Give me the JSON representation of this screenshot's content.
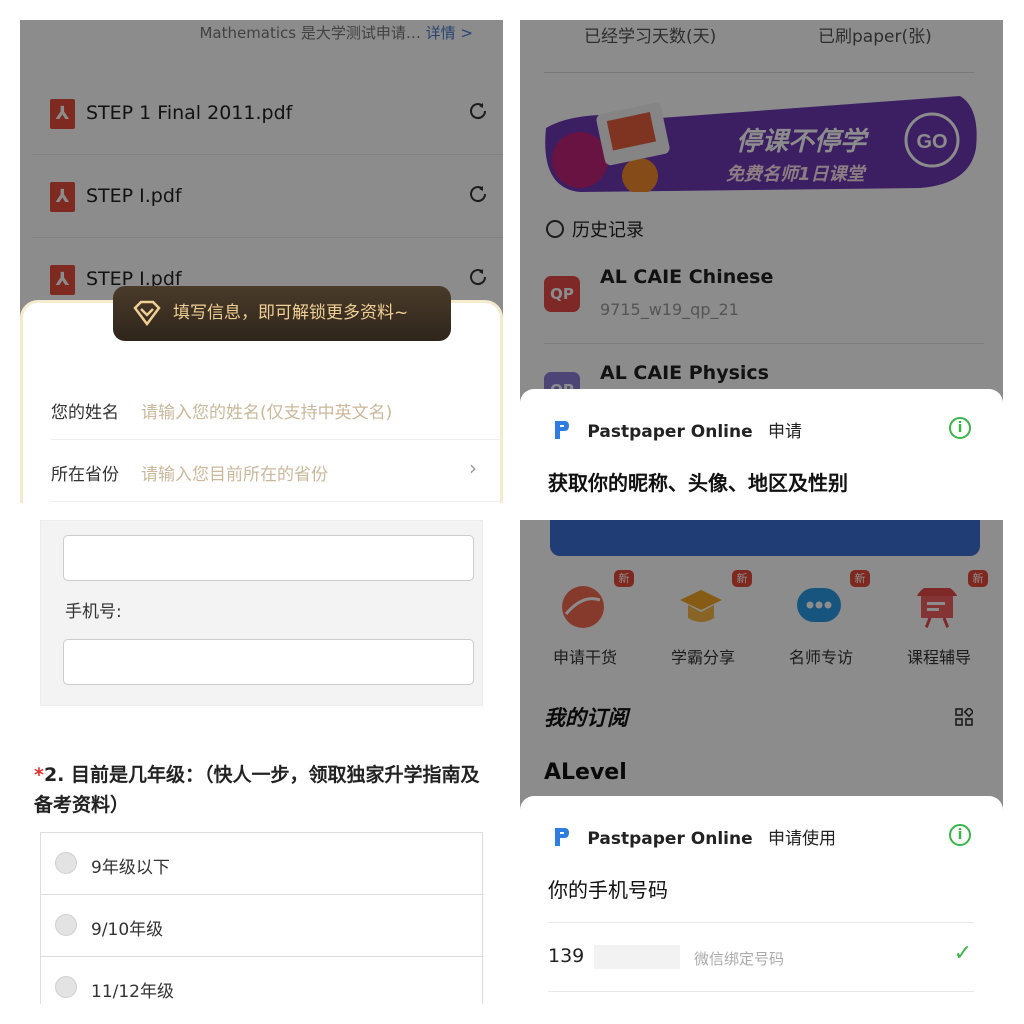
{
  "panel1": {
    "top_text": "Mathematics 是大学测试申请…",
    "top_link": "详情 >",
    "files": [
      "STEP 1 Final 2011.pdf",
      "STEP I.pdf",
      "STEP I.pdf"
    ],
    "banner": "填写信息，即可解锁更多资料~",
    "name_label": "您的姓名",
    "name_placeholder": "请输入您的姓名(仅支持中英文名)",
    "province_label": "所在省份",
    "province_placeholder": "请输入您目前所在的省份"
  },
  "panel2": {
    "stat_days": "已经学习天数(天)",
    "stat_papers": "已刷paper(张)",
    "banner_main": "停课不停学",
    "banner_sub": "免费名师1日课堂",
    "banner_go": "GO",
    "history_title": "历史记录",
    "history": [
      {
        "badge": "QP",
        "title": "AL CAIE Chinese",
        "sub": "9715_w19_qp_21"
      },
      {
        "badge": "QP",
        "title": "AL CAIE Physics",
        "sub": ""
      }
    ],
    "auth_app": "Pastpaper Online",
    "auth_action": "申请",
    "auth_title": "获取你的昵称、头像、地区及性别"
  },
  "panel3": {
    "phone_label": "手机号:",
    "question_req": "*",
    "question": "2. 目前是几年级：（快人一步，领取独家升学指南及备考资料）",
    "options": [
      "9年级以下",
      "9/10年级",
      "11/12年级"
    ]
  },
  "panel4": {
    "quick": [
      {
        "label": "申请干货",
        "badge": "新"
      },
      {
        "label": "学霸分享",
        "badge": "新"
      },
      {
        "label": "名师专访",
        "badge": "新"
      },
      {
        "label": "课程辅导",
        "badge": "新"
      }
    ],
    "subscription_title": "我的订阅",
    "section": "ALevel",
    "auth_app": "Pastpaper Online",
    "auth_action": "申请使用",
    "auth_title": "你的手机号码",
    "phone_prefix": "139",
    "phone_tag": "微信绑定号码",
    "check": "✓"
  },
  "colors": {
    "accent": "#3ab54a",
    "pdf": "#e64d3c",
    "link": "#4a7cd4",
    "banner_gold": "#f0cf95",
    "badge_red": "#e84a4a"
  }
}
